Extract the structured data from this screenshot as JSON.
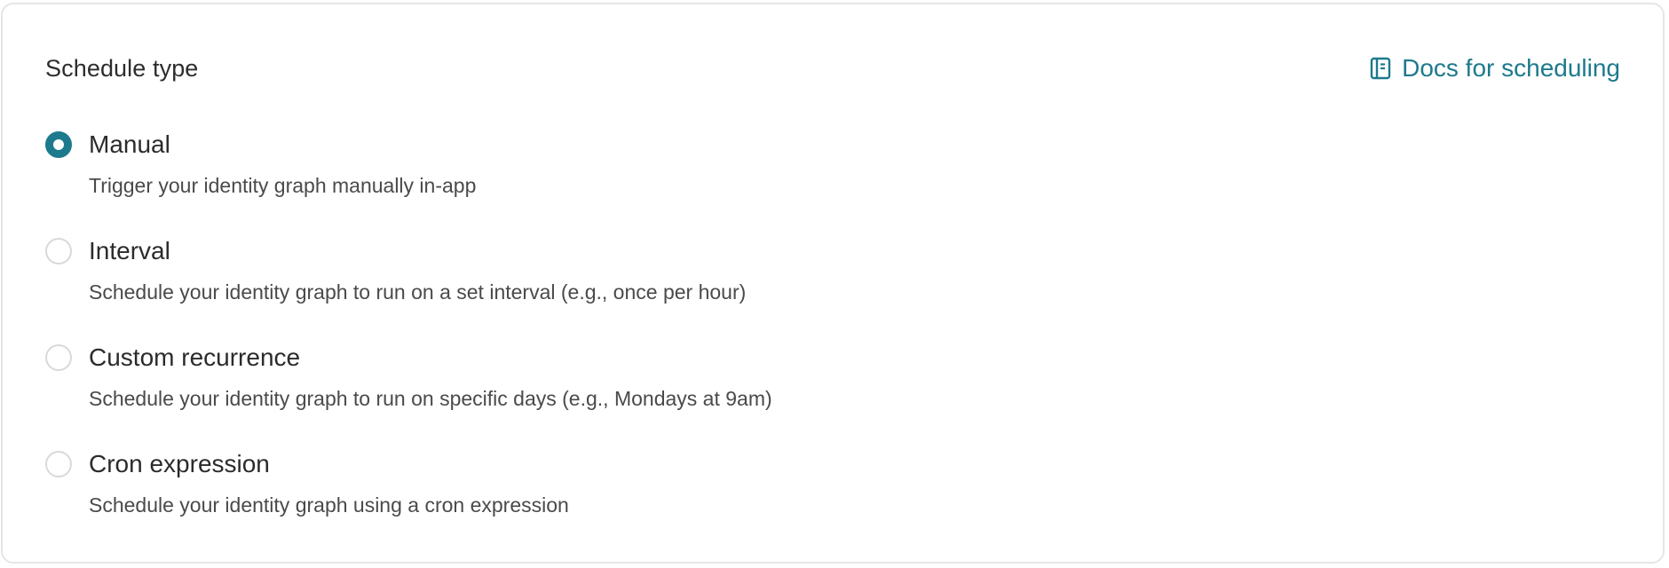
{
  "card": {
    "title": "Schedule type",
    "docs_link": {
      "label": "Docs for scheduling",
      "icon": "book-icon"
    }
  },
  "options": [
    {
      "label": "Manual",
      "description": "Trigger your identity graph manually in-app",
      "selected": true
    },
    {
      "label": "Interval",
      "description": "Schedule your identity graph to run on a set interval (e.g., once per hour)",
      "selected": false
    },
    {
      "label": "Custom recurrence",
      "description": "Schedule your identity graph to run on specific days (e.g., Mondays at 9am)",
      "selected": false
    },
    {
      "label": "Cron expression",
      "description": "Schedule your identity graph using a cron expression",
      "selected": false
    }
  ],
  "colors": {
    "accent": "#1d7a8c",
    "text": "#2b2b2b",
    "muted_text": "#4a4a4a",
    "border": "#e6e6e6"
  }
}
